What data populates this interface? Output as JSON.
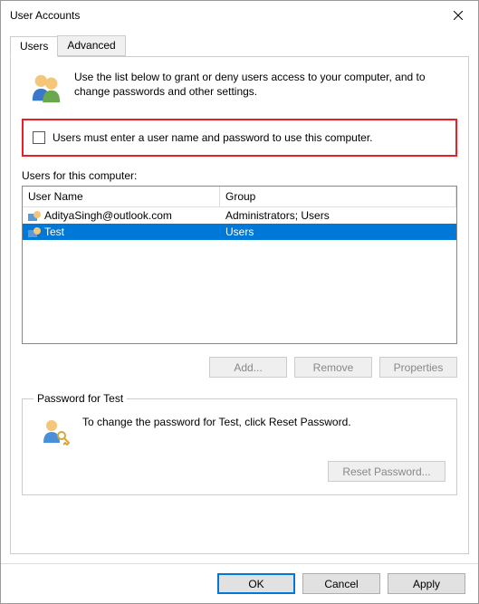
{
  "window": {
    "title": "User Accounts"
  },
  "tabs": {
    "users": "Users",
    "advanced": "Advanced"
  },
  "intro": "Use the list below to grant or deny users access to your computer, and to change passwords and other settings.",
  "checkbox": {
    "label": "Users must enter a user name and password to use this computer."
  },
  "users_section": {
    "label": "Users for this computer:",
    "columns": {
      "user": "User Name",
      "group": "Group"
    },
    "rows": [
      {
        "user": "AdityaSingh@outlook.com",
        "group": "Administrators; Users",
        "selected": false
      },
      {
        "user": "Test",
        "group": "Users",
        "selected": true
      }
    ]
  },
  "buttons": {
    "add": "Add...",
    "remove": "Remove",
    "properties": "Properties",
    "reset_password": "Reset Password...",
    "ok": "OK",
    "cancel": "Cancel",
    "apply": "Apply"
  },
  "password_group": {
    "legend": "Password for Test",
    "text": "To change the password for Test, click Reset Password."
  }
}
